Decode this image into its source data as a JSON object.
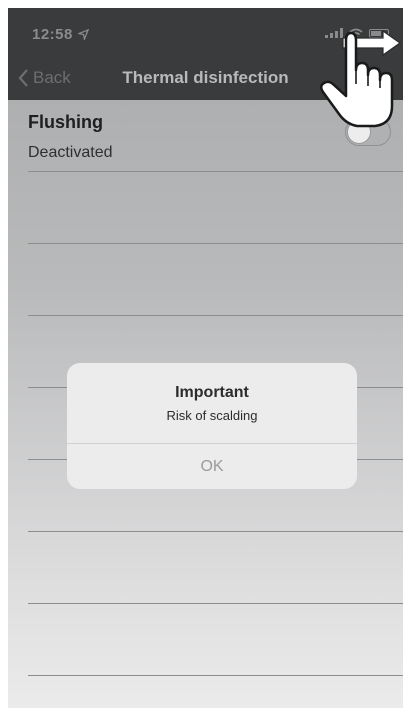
{
  "status_bar": {
    "time": "12:58",
    "location_icon": "location-arrow-icon",
    "signal_icon": "cellular-signal-icon",
    "wifi_icon": "wifi-icon",
    "battery_icon": "battery-icon"
  },
  "nav_bar": {
    "back_label": "Back",
    "back_icon": "chevron-left-icon",
    "title": "Thermal disinfection"
  },
  "setting": {
    "title": "Flushing",
    "status": "Deactivated",
    "toggle_on": false
  },
  "overlay": {
    "hand_icon": "pointing-hand-icon",
    "arrow_icon": "swipe-right-arrow-icon"
  },
  "alert": {
    "title": "Important",
    "message": "Risk of scalding",
    "ok_label": "OK"
  }
}
